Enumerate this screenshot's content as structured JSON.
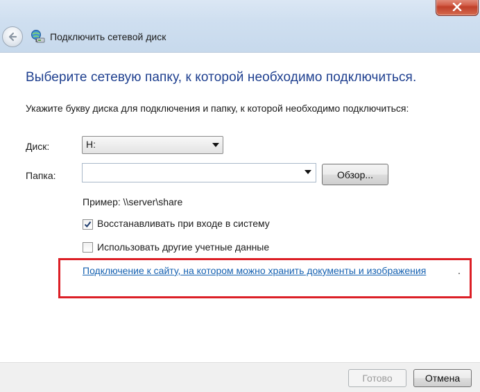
{
  "window": {
    "title": "Подключить сетевой диск"
  },
  "main": {
    "heading": "Выберите сетевую папку, к которой необходимо подключиться.",
    "instruction": "Укажите букву диска для подключения и папку, к которой необходимо подключиться:",
    "drive_label": "Диск:",
    "drive_value": "H:",
    "folder_label": "Папка:",
    "folder_value": "",
    "browse_label": "Обзор...",
    "example": "Пример: \\\\server\\share",
    "reconnect_label": "Восстанавливать при входе в систему",
    "reconnect_checked": true,
    "other_creds_label": "Использовать другие учетные данные",
    "other_creds_checked": false,
    "link_text": "Подключение к сайту, на котором можно хранить документы и изображения",
    "link_period": "."
  },
  "footer": {
    "done_label": "Готово",
    "done_enabled": false,
    "cancel_label": "Отмена"
  },
  "colors": {
    "heading": "#1e3f8f",
    "link": "#1561b1",
    "highlight_border": "#dc1f26"
  },
  "icons": {
    "close": "close-icon",
    "back": "back-arrow-icon",
    "wizard": "network-drive-icon",
    "dropdown": "chevron-down-icon",
    "check": "checkmark-icon"
  }
}
